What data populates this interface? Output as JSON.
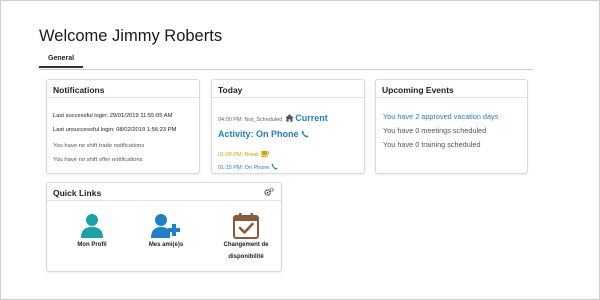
{
  "header": {
    "welcome": "Welcome Jimmy Roberts"
  },
  "tabs": [
    {
      "label": "General",
      "active": true
    }
  ],
  "notifications": {
    "title": "Notifications",
    "last_success": "Last successful login: 29/01/2019 11:55:05 AM",
    "last_fail": "Last unsuccessful login: 08/02/2019 1:56:23 PM",
    "no_trade": "You have no shift trade notifications",
    "no_offer": "You have no shift offer notifications"
  },
  "today": {
    "title": "Today",
    "status_time": "04:00 PM: Not_Scheduled",
    "current_label": "Current",
    "activity": "Activity: On Phone",
    "break_item": "01:00 PM: Break",
    "phone_item": "01:15 PM: On Phone"
  },
  "upcoming": {
    "title": "Upcoming Events",
    "vacation": "You have 2 approved vacation days",
    "meetings": "You have 0 meetings scheduled",
    "training": "You have 0 training scheduled"
  },
  "quick_links": {
    "title": "Quick Links",
    "items": [
      {
        "label": "Mon Profil",
        "icon": "user-icon"
      },
      {
        "label": "Mes ami(e)s",
        "icon": "add-user-icon"
      },
      {
        "label": "Changement de",
        "label2": "disponibilité",
        "icon": "calendar-check-icon"
      }
    ]
  },
  "colors": {
    "accent": "#1f7fc7",
    "teal": "#1aa3a3",
    "warning": "#e0a000",
    "calendar": "#8a5a3c"
  }
}
